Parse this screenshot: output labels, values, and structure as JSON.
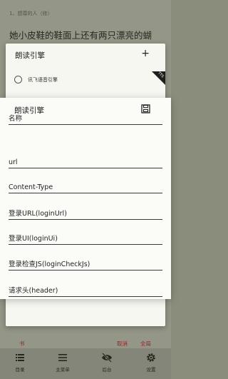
{
  "reader": {
    "chapter_title": "1、想尊的人（修）",
    "body_line": "她小皮鞋的鞋面上还有两只漂亮的蝴"
  },
  "outer_dialog": {
    "title": "朗读引擎",
    "add_symbol": "+",
    "engines": [
      {
        "label": "讯飞语音引擎",
        "badge": "TTS",
        "selected": false
      }
    ]
  },
  "edit_dialog": {
    "title": "朗读引擎",
    "save_icon": "save-icon",
    "fields": [
      {
        "label": "名称"
      },
      {
        "label": "url"
      },
      {
        "label": "Content-Type"
      },
      {
        "label": "登录URL(loginUrl)"
      },
      {
        "label": "登录UI(loginUi)"
      },
      {
        "label": "登录检查JS(loginCheckJs)"
      },
      {
        "label": "请求头(header)"
      }
    ]
  },
  "dialog_actions": {
    "left": "书",
    "cancel": "取消",
    "all": "全局"
  },
  "bottom_nav": [
    {
      "label": "目录",
      "icon": "list-icon"
    },
    {
      "label": "主菜单",
      "icon": "menu-icon"
    },
    {
      "label": "后台",
      "icon": "eye-off-icon"
    },
    {
      "label": "设置",
      "icon": "gear-icon"
    }
  ],
  "colors": {
    "reader_bg": "#e9ecd9",
    "dialog_bg": "#fbfbf8",
    "accent": "#8a2b2b"
  }
}
